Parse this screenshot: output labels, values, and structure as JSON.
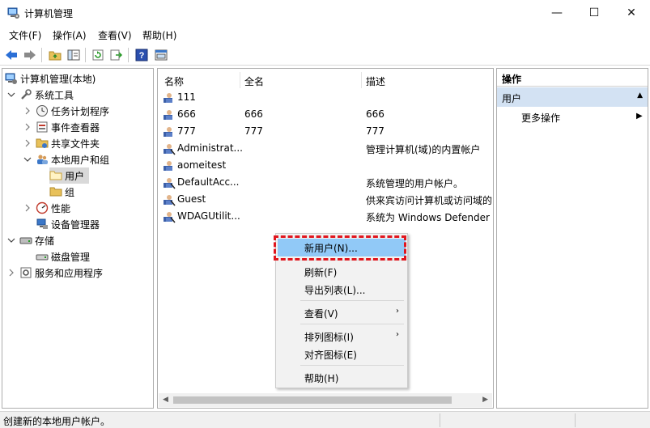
{
  "window": {
    "title": "计算机管理",
    "minimize": "—",
    "maximize": "☐",
    "close": "✕"
  },
  "menubar": [
    "文件(F)",
    "操作(A)",
    "查看(V)",
    "帮助(H)"
  ],
  "toolbar": [
    "back-arrow-icon",
    "forward-arrow-icon",
    "up-folder-icon",
    "show-tree-icon",
    "refresh-icon",
    "export-list-icon",
    "help-icon",
    "properties-icon"
  ],
  "tree": {
    "root": "计算机管理(本地)",
    "system_tools": "系统工具",
    "task_scheduler": "任务计划程序",
    "event_viewer": "事件查看器",
    "shared_folders": "共享文件夹",
    "local_users_groups": "本地用户和组",
    "users": "用户",
    "groups": "组",
    "performance": "性能",
    "device_manager": "设备管理器",
    "storage": "存储",
    "disk_management": "磁盘管理",
    "services_apps": "服务和应用程序"
  },
  "columns": {
    "name": "名称",
    "fullname": "全名",
    "description": "描述"
  },
  "users": [
    {
      "name": "111",
      "fullname": "",
      "description": ""
    },
    {
      "name": "666",
      "fullname": "666",
      "description": "666"
    },
    {
      "name": "777",
      "fullname": "777",
      "description": "777"
    },
    {
      "name": "Administrat...",
      "fullname": "",
      "description": "管理计算机(域)的内置帐户"
    },
    {
      "name": "aomeitest",
      "fullname": "",
      "description": ""
    },
    {
      "name": "DefaultAcc...",
      "fullname": "",
      "description": "系统管理的用户帐户。"
    },
    {
      "name": "Guest",
      "fullname": "",
      "description": "供来宾访问计算机或访问域的"
    },
    {
      "name": "WDAGUtilit...",
      "fullname": "",
      "description": "系统为 Windows Defender"
    }
  ],
  "context_menu": {
    "new_user": "新用户(N)...",
    "refresh": "刷新(F)",
    "export_list": "导出列表(L)...",
    "view": "查看(V)",
    "arrange_icons": "排列图标(I)",
    "line_up_icons": "对齐图标(E)",
    "help": "帮助(H)"
  },
  "actions": {
    "header": "操作",
    "section": "用户",
    "more": "更多操作"
  },
  "status": {
    "text": "创建新的本地用户帐户。"
  },
  "colors": {
    "accent": "#d3e2f3",
    "menu_highlight": "#91c9f7",
    "callout": "#e0161e"
  }
}
